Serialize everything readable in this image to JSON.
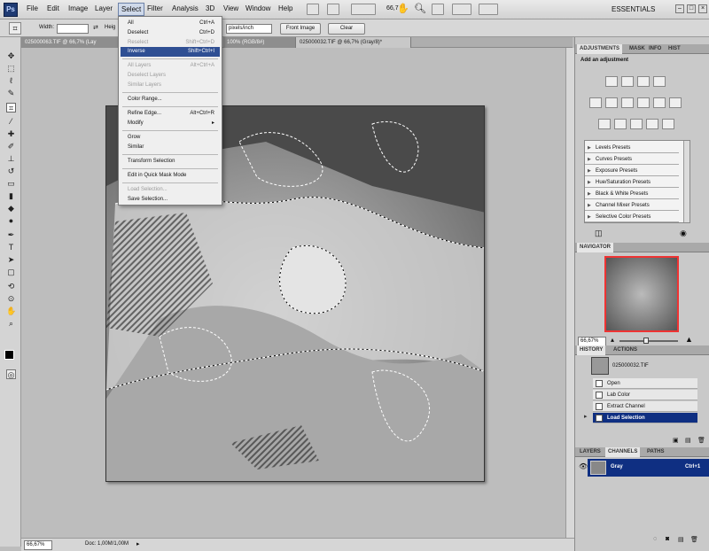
{
  "app": {
    "logo": "Ps",
    "workspace": "ESSENTIALS",
    "zoom_box": "66,7"
  },
  "menus": [
    "File",
    "Edit",
    "Image",
    "Layer",
    "Select",
    "Filter",
    "Analysis",
    "3D",
    "View",
    "Window",
    "Help"
  ],
  "options_bar": {
    "width_label": "Width:",
    "height_label": "Heig",
    "resolution_unit": "pixels/inch",
    "front_image": "Front Image",
    "clear": "Clear"
  },
  "doc_tabs": [
    {
      "label": "025000063.TIF @ 66,7% (Lay"
    },
    {
      "label": "100% (RGB/8#)"
    },
    {
      "label": "025000032.TIF @ 66,7% (Gray/8)*"
    }
  ],
  "select_menu": {
    "items": [
      {
        "label": "All",
        "shortcut": "Ctrl+A",
        "state": "normal"
      },
      {
        "label": "Deselect",
        "shortcut": "Ctrl+D",
        "state": "normal"
      },
      {
        "label": "Reselect",
        "shortcut": "Shift+Ctrl+D",
        "state": "disabled"
      },
      {
        "label": "Inverse",
        "shortcut": "Shift+Ctrl+I",
        "state": "highlighted"
      },
      {
        "label": "All Layers",
        "shortcut": "Alt+Ctrl+A",
        "state": "disabled"
      },
      {
        "label": "Deselect Layers",
        "shortcut": "",
        "state": "disabled"
      },
      {
        "label": "Similar Layers",
        "shortcut": "",
        "state": "disabled"
      },
      {
        "label": "Color Range...",
        "shortcut": "",
        "state": "normal"
      },
      {
        "label": "Refine Edge...",
        "shortcut": "Alt+Ctrl+R",
        "state": "normal"
      },
      {
        "label": "Modify",
        "shortcut": "▸",
        "state": "normal"
      },
      {
        "label": "Grow",
        "shortcut": "",
        "state": "normal"
      },
      {
        "label": "Similar",
        "shortcut": "",
        "state": "normal"
      },
      {
        "label": "Transform Selection",
        "shortcut": "",
        "state": "normal"
      },
      {
        "label": "Edit in Quick Mask Mode",
        "shortcut": "",
        "state": "normal"
      },
      {
        "label": "Load Selection...",
        "shortcut": "",
        "state": "disabled"
      },
      {
        "label": "Save Selection...",
        "shortcut": "",
        "state": "normal"
      }
    ]
  },
  "adjustments_panel": {
    "tabs": [
      "ADJUSTMENTS",
      "MASK",
      "INFO",
      "HIST"
    ],
    "heading": "Add an adjustment",
    "presets": [
      "Levels Presets",
      "Curves Presets",
      "Exposure Presets",
      "Hue/Saturation Presets",
      "Black & White Presets",
      "Channel Mixer Presets",
      "Selective Color Presets"
    ]
  },
  "navigator": {
    "tab": "NAVIGATOR",
    "zoom": "66,67%"
  },
  "history": {
    "tabs": [
      "HISTORY",
      "ACTIONS"
    ],
    "snapshot": "025000032.TIF",
    "items": [
      {
        "label": "Open",
        "selected": false
      },
      {
        "label": "Lab Color",
        "selected": false
      },
      {
        "label": "Extract Channel",
        "selected": false
      },
      {
        "label": "Load Selection",
        "selected": true
      }
    ]
  },
  "layers": {
    "tabs": [
      "LAYERS",
      "CHANNELS",
      "PATHS"
    ],
    "channel": {
      "name": "Gray",
      "shortcut": "Ctrl+1"
    }
  },
  "status": {
    "zoom": "66,67%",
    "doc": "Doc: 1,00M/1,00M"
  }
}
